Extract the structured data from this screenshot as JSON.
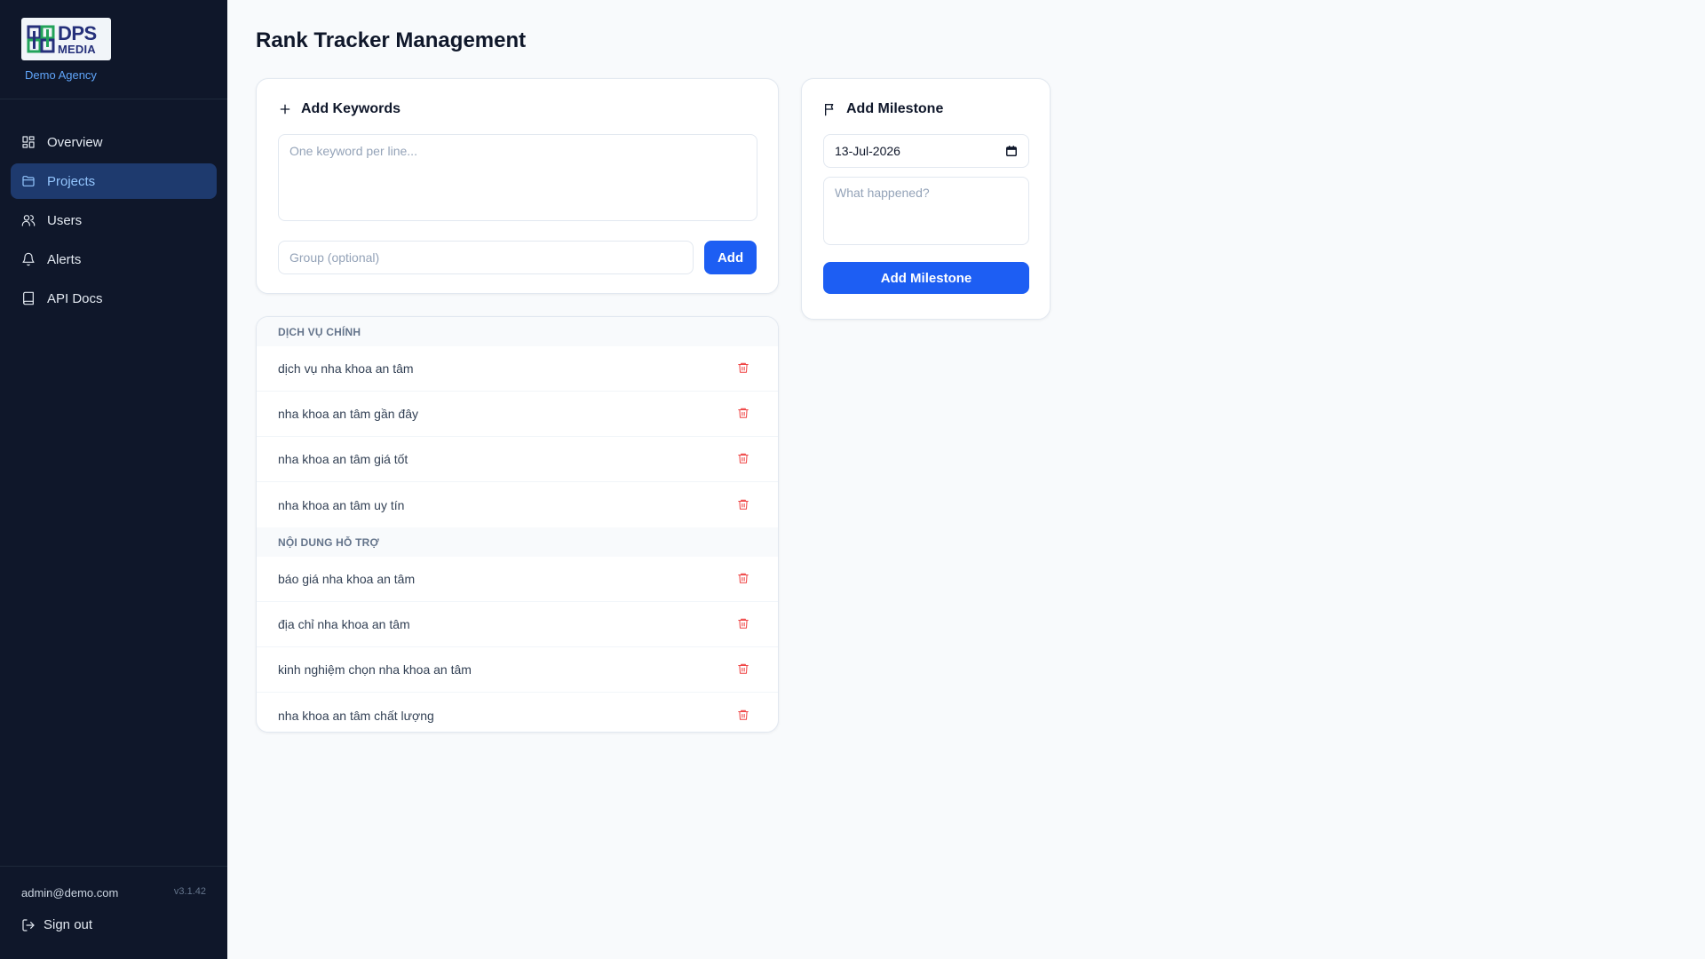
{
  "sidebar": {
    "logo_line1": "DPS",
    "logo_line2": "MEDIA",
    "agency": "Demo Agency",
    "items": [
      {
        "label": "Overview",
        "icon": "grid-icon"
      },
      {
        "label": "Projects",
        "icon": "folder-icon"
      },
      {
        "label": "Users",
        "icon": "users-icon"
      },
      {
        "label": "Alerts",
        "icon": "bell-icon"
      },
      {
        "label": "API Docs",
        "icon": "book-icon"
      }
    ],
    "active_item": "Projects",
    "email": "admin@demo.com",
    "version": "v3.1.42",
    "signout": "Sign out"
  },
  "colors": {
    "sidebar_bg": "#0f172a",
    "accent": "#1d5ef3",
    "active_bg": "#1e3a6e",
    "danger": "#ef4444"
  },
  "main": {
    "title": "Rank Tracker Management"
  },
  "keywords_card": {
    "title": "Add Keywords",
    "textarea_placeholder": "One keyword per line...",
    "group_placeholder": "Group (optional)",
    "add_label": "Add"
  },
  "milestone_card": {
    "title": "Add Milestone",
    "date_value": "13-Jul-2026",
    "note_placeholder": "What happened?",
    "button_label": "Add Milestone"
  },
  "keyword_groups": [
    {
      "name": "DỊCH VỤ CHÍNH",
      "keywords": [
        "dịch vụ nha khoa an tâm",
        "nha khoa an tâm gần đây",
        "nha khoa an tâm giá tốt",
        "nha khoa an tâm uy tín"
      ]
    },
    {
      "name": "NỘI DUNG HỖ TRỢ",
      "keywords": [
        "báo giá nha khoa an tâm",
        "địa chỉ nha khoa an tâm",
        "kinh nghiệm chọn nha khoa an tâm",
        "nha khoa an tâm chất lượng"
      ]
    }
  ]
}
